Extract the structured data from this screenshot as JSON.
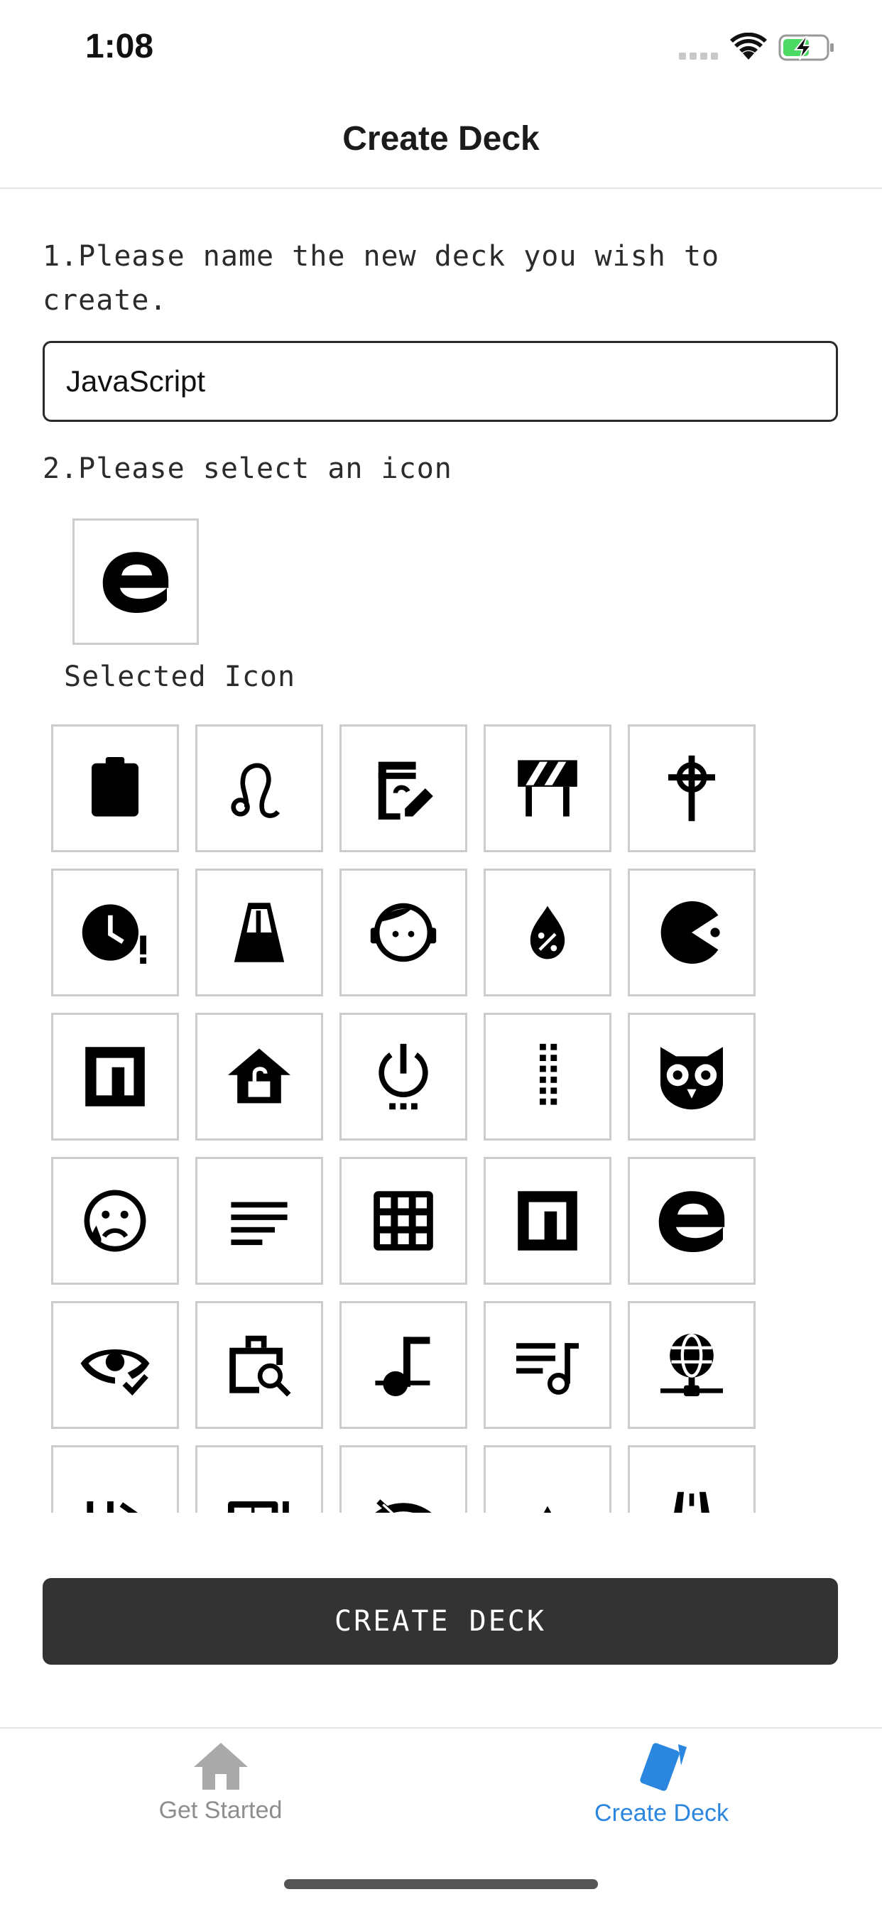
{
  "status_bar": {
    "time": "1:08"
  },
  "header": {
    "title": "Create Deck"
  },
  "form": {
    "step1_label": "1.Please name the new deck you wish to create.",
    "deck_name_value": "JavaScript",
    "step2_label": "2.Please select an icon",
    "selected_icon": "edge-e-icon",
    "selected_icon_label": "Selected Icon"
  },
  "icon_grid": {
    "icons": [
      "clipboard-icon",
      "leo-icon",
      "edit-calendar-icon",
      "construction-barrier-icon",
      "celtic-cross-icon",
      "clock-alert-icon",
      "metronome-icon",
      "support-agent-icon",
      "percent-drop-icon",
      "pacman-icon",
      "npm-icon",
      "home-lock-open-icon",
      "power-settings-icon",
      "dots-vertical-icon",
      "owl-icon",
      "emoticon-cry-icon",
      "format-align-left-icon",
      "grid-icon",
      "npm-icon",
      "edge-e-icon",
      "eye-check-icon",
      "briefcase-search-icon",
      "music-note-icon",
      "playlist-music-icon",
      "web-network-icon",
      "code-tags-icon",
      "bookshelf-icon",
      "wifi-off-icon",
      "triangle-icon",
      "road-icon"
    ]
  },
  "actions": {
    "create_button_label": "CREATE DECK"
  },
  "tab_bar": {
    "tabs": [
      {
        "label": "Get Started",
        "icon": "home-icon",
        "active": false
      },
      {
        "label": "Create Deck",
        "icon": "cards-icon",
        "active": true
      }
    ]
  },
  "colors": {
    "active_tab": "#2a86de",
    "inactive_tab": "#8e8e8e",
    "button_bg": "#333333",
    "cell_border": "#cccccc"
  }
}
